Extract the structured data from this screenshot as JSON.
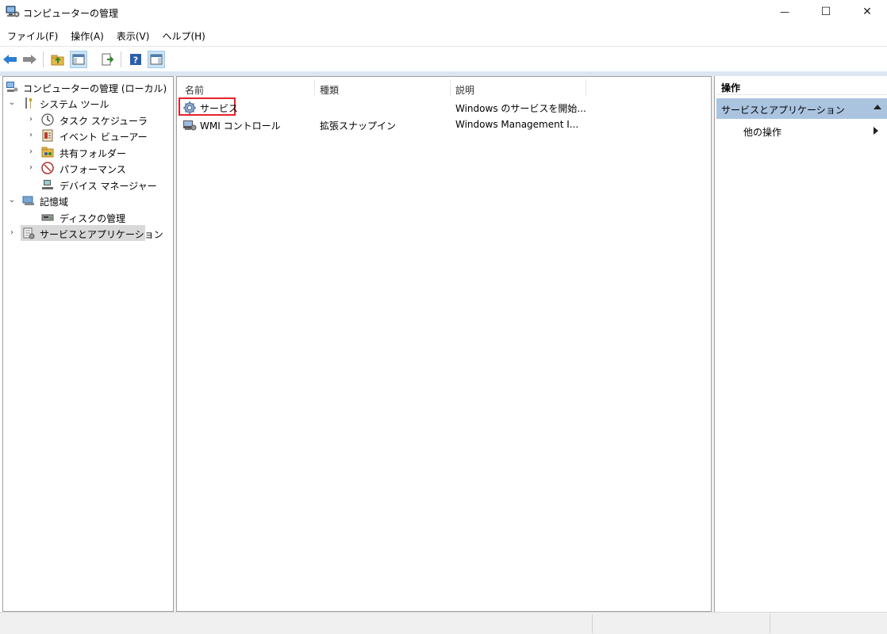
{
  "window": {
    "title": "コンピューターの管理",
    "minimize_glyph": "—",
    "maximize_glyph": "☐",
    "close_glyph": "✕"
  },
  "menu": {
    "items": [
      {
        "label": "ファイル(F)"
      },
      {
        "label": "操作(A)"
      },
      {
        "label": "表示(V)"
      },
      {
        "label": "ヘルプ(H)"
      }
    ]
  },
  "toolbar": {
    "icons": [
      "back-icon",
      "forward-icon",
      "up-folder-icon",
      "show-hide-tree-icon",
      "export-list-icon",
      "help-icon",
      "show-action-pane-icon"
    ]
  },
  "tree": {
    "root": {
      "label": "コンピューターの管理 (ローカル)"
    },
    "items": [
      {
        "label": "システム ツール",
        "chevron": "⌄"
      },
      {
        "label": "タスク スケジューラ",
        "chevron": "›"
      },
      {
        "label": "イベント ビューアー",
        "chevron": "›"
      },
      {
        "label": "共有フォルダー",
        "chevron": "›"
      },
      {
        "label": "パフォーマンス",
        "chevron": "›"
      },
      {
        "label": "デバイス マネージャー",
        "chevron": ""
      },
      {
        "label": "記憶域",
        "chevron": "⌄"
      },
      {
        "label": "ディスクの管理",
        "chevron": ""
      },
      {
        "label": "サービスとアプリケーション",
        "chevron": "›"
      }
    ]
  },
  "list": {
    "columns": [
      {
        "label": "名前"
      },
      {
        "label": "種類"
      },
      {
        "label": "説明"
      }
    ],
    "rows": [
      {
        "name": "サービス",
        "type": "",
        "description": "Windows のサービスを開始..."
      },
      {
        "name": "WMI コントロール",
        "type": "拡張スナップイン",
        "description": "Windows Management I..."
      }
    ]
  },
  "actions": {
    "header": "操作",
    "group": "サービスとアプリケーション",
    "items": [
      {
        "label": "他の操作"
      }
    ]
  },
  "colors": {
    "accent_highlight": "#e8212a",
    "action_group_bg": "#aac4e0",
    "tree_selected_bg": "#d9d9d9"
  }
}
